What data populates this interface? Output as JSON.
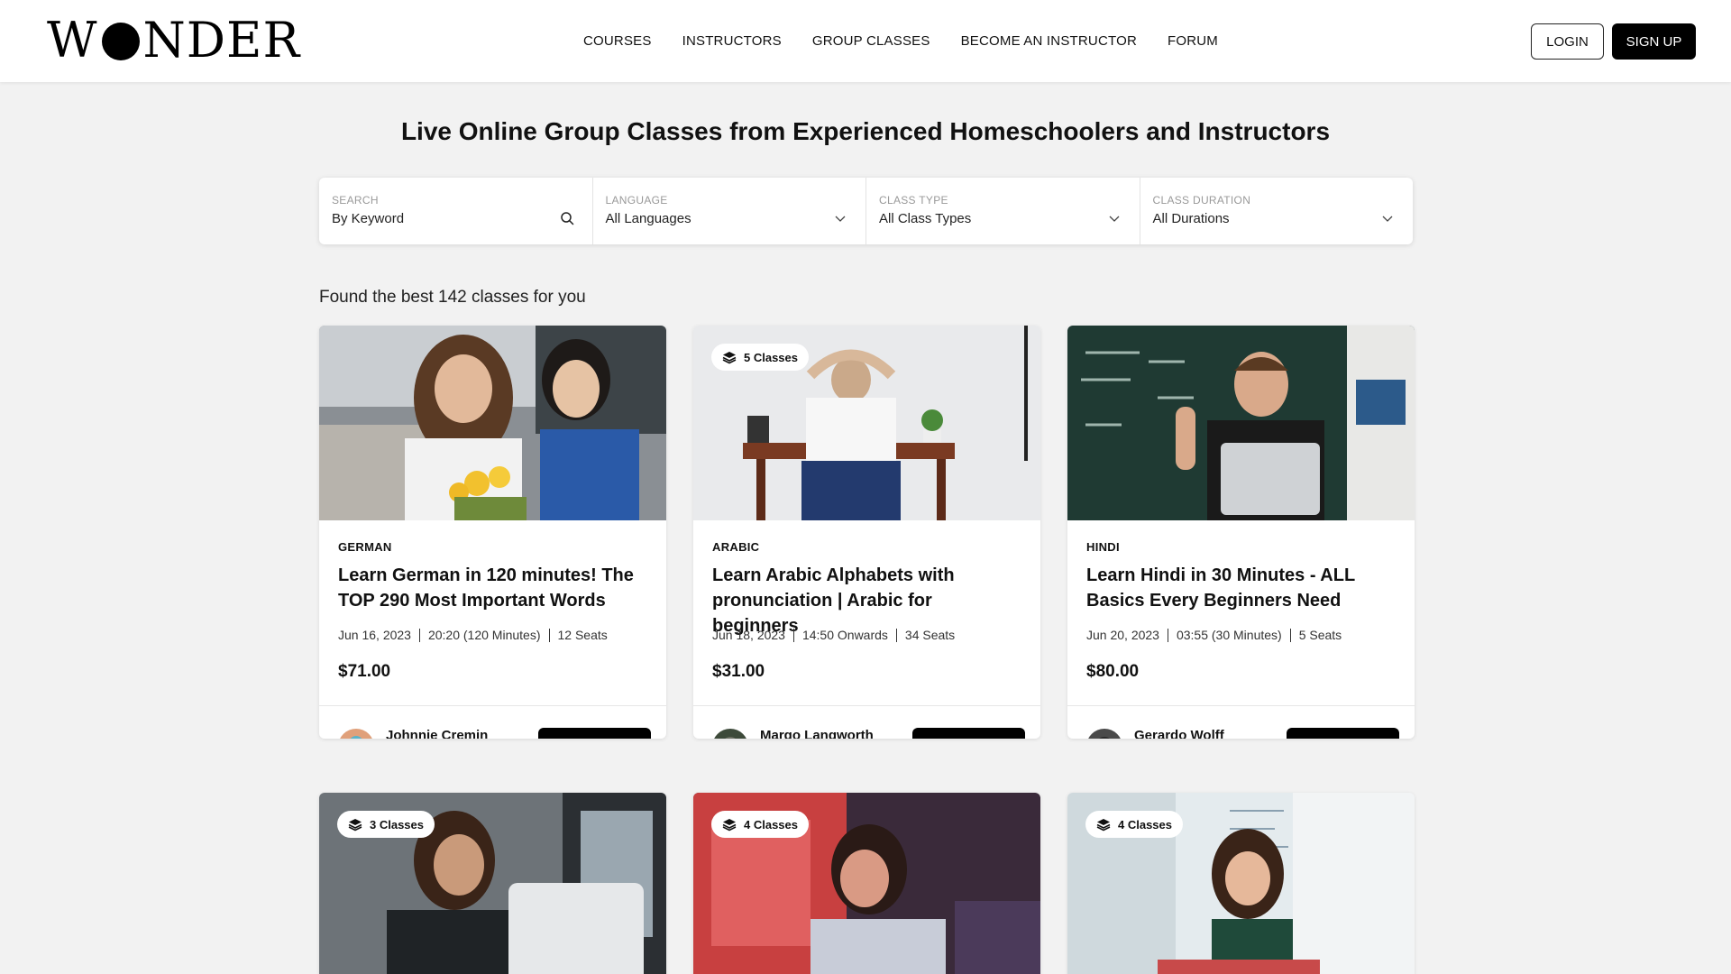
{
  "brand": {
    "logo_text_left": "W",
    "logo_text_right": "NDER",
    "logo_full": "WONDER"
  },
  "nav": {
    "links": [
      "COURSES",
      "INSTRUCTORS",
      "GROUP CLASSES",
      "BECOME AN INSTRUCTOR",
      "FORUM"
    ],
    "login": "LOGIN",
    "signup": "SIGN UP"
  },
  "hero": {
    "title": "Live Online Group Classes from Experienced Homeschoolers and Instructors"
  },
  "filters": [
    {
      "label": "SEARCH",
      "value": "By Keyword",
      "icon": "search-icon"
    },
    {
      "label": "LANGUAGE",
      "value": "All Languages",
      "icon": "chevron-down-icon"
    },
    {
      "label": "CLASS TYPE",
      "value": "All Class Types",
      "icon": "chevron-down-icon"
    },
    {
      "label": "CLASS DURATION",
      "value": "All Durations",
      "icon": "chevron-down-icon"
    }
  ],
  "results": {
    "text": "Found the best 142 classes for you"
  },
  "cards": [
    {
      "category": "GERMAN",
      "title": "Learn German in 120 minutes! The TOP 290 Most Important Words",
      "date": "Jun 16, 2023",
      "time": "20:20 (120 Minutes)",
      "seats": "12 Seats",
      "price": "$71.00",
      "instructor": "Johnnie Cremin",
      "badge": ""
    },
    {
      "category": "ARABIC",
      "title": "Learn Arabic Alphabets with pronunciation | Arabic for beginners",
      "date": "Jun 18, 2023",
      "time": "14:50 Onwards",
      "seats": "34 Seats",
      "price": "$31.00",
      "instructor": "Margo Langworth",
      "badge": "5 Classes"
    },
    {
      "category": "HINDI",
      "title": "Learn Hindi in 30 Minutes - ALL Basics Every Beginners Need",
      "date": "Jun 20, 2023",
      "time": "03:55 (30 Minutes)",
      "seats": "5 Seats",
      "price": "$80.00",
      "instructor": "Gerardo Wolff",
      "badge": ""
    },
    {
      "badge": "3 Classes"
    },
    {
      "badge": "4 Classes"
    },
    {
      "badge": "4 Classes"
    }
  ]
}
